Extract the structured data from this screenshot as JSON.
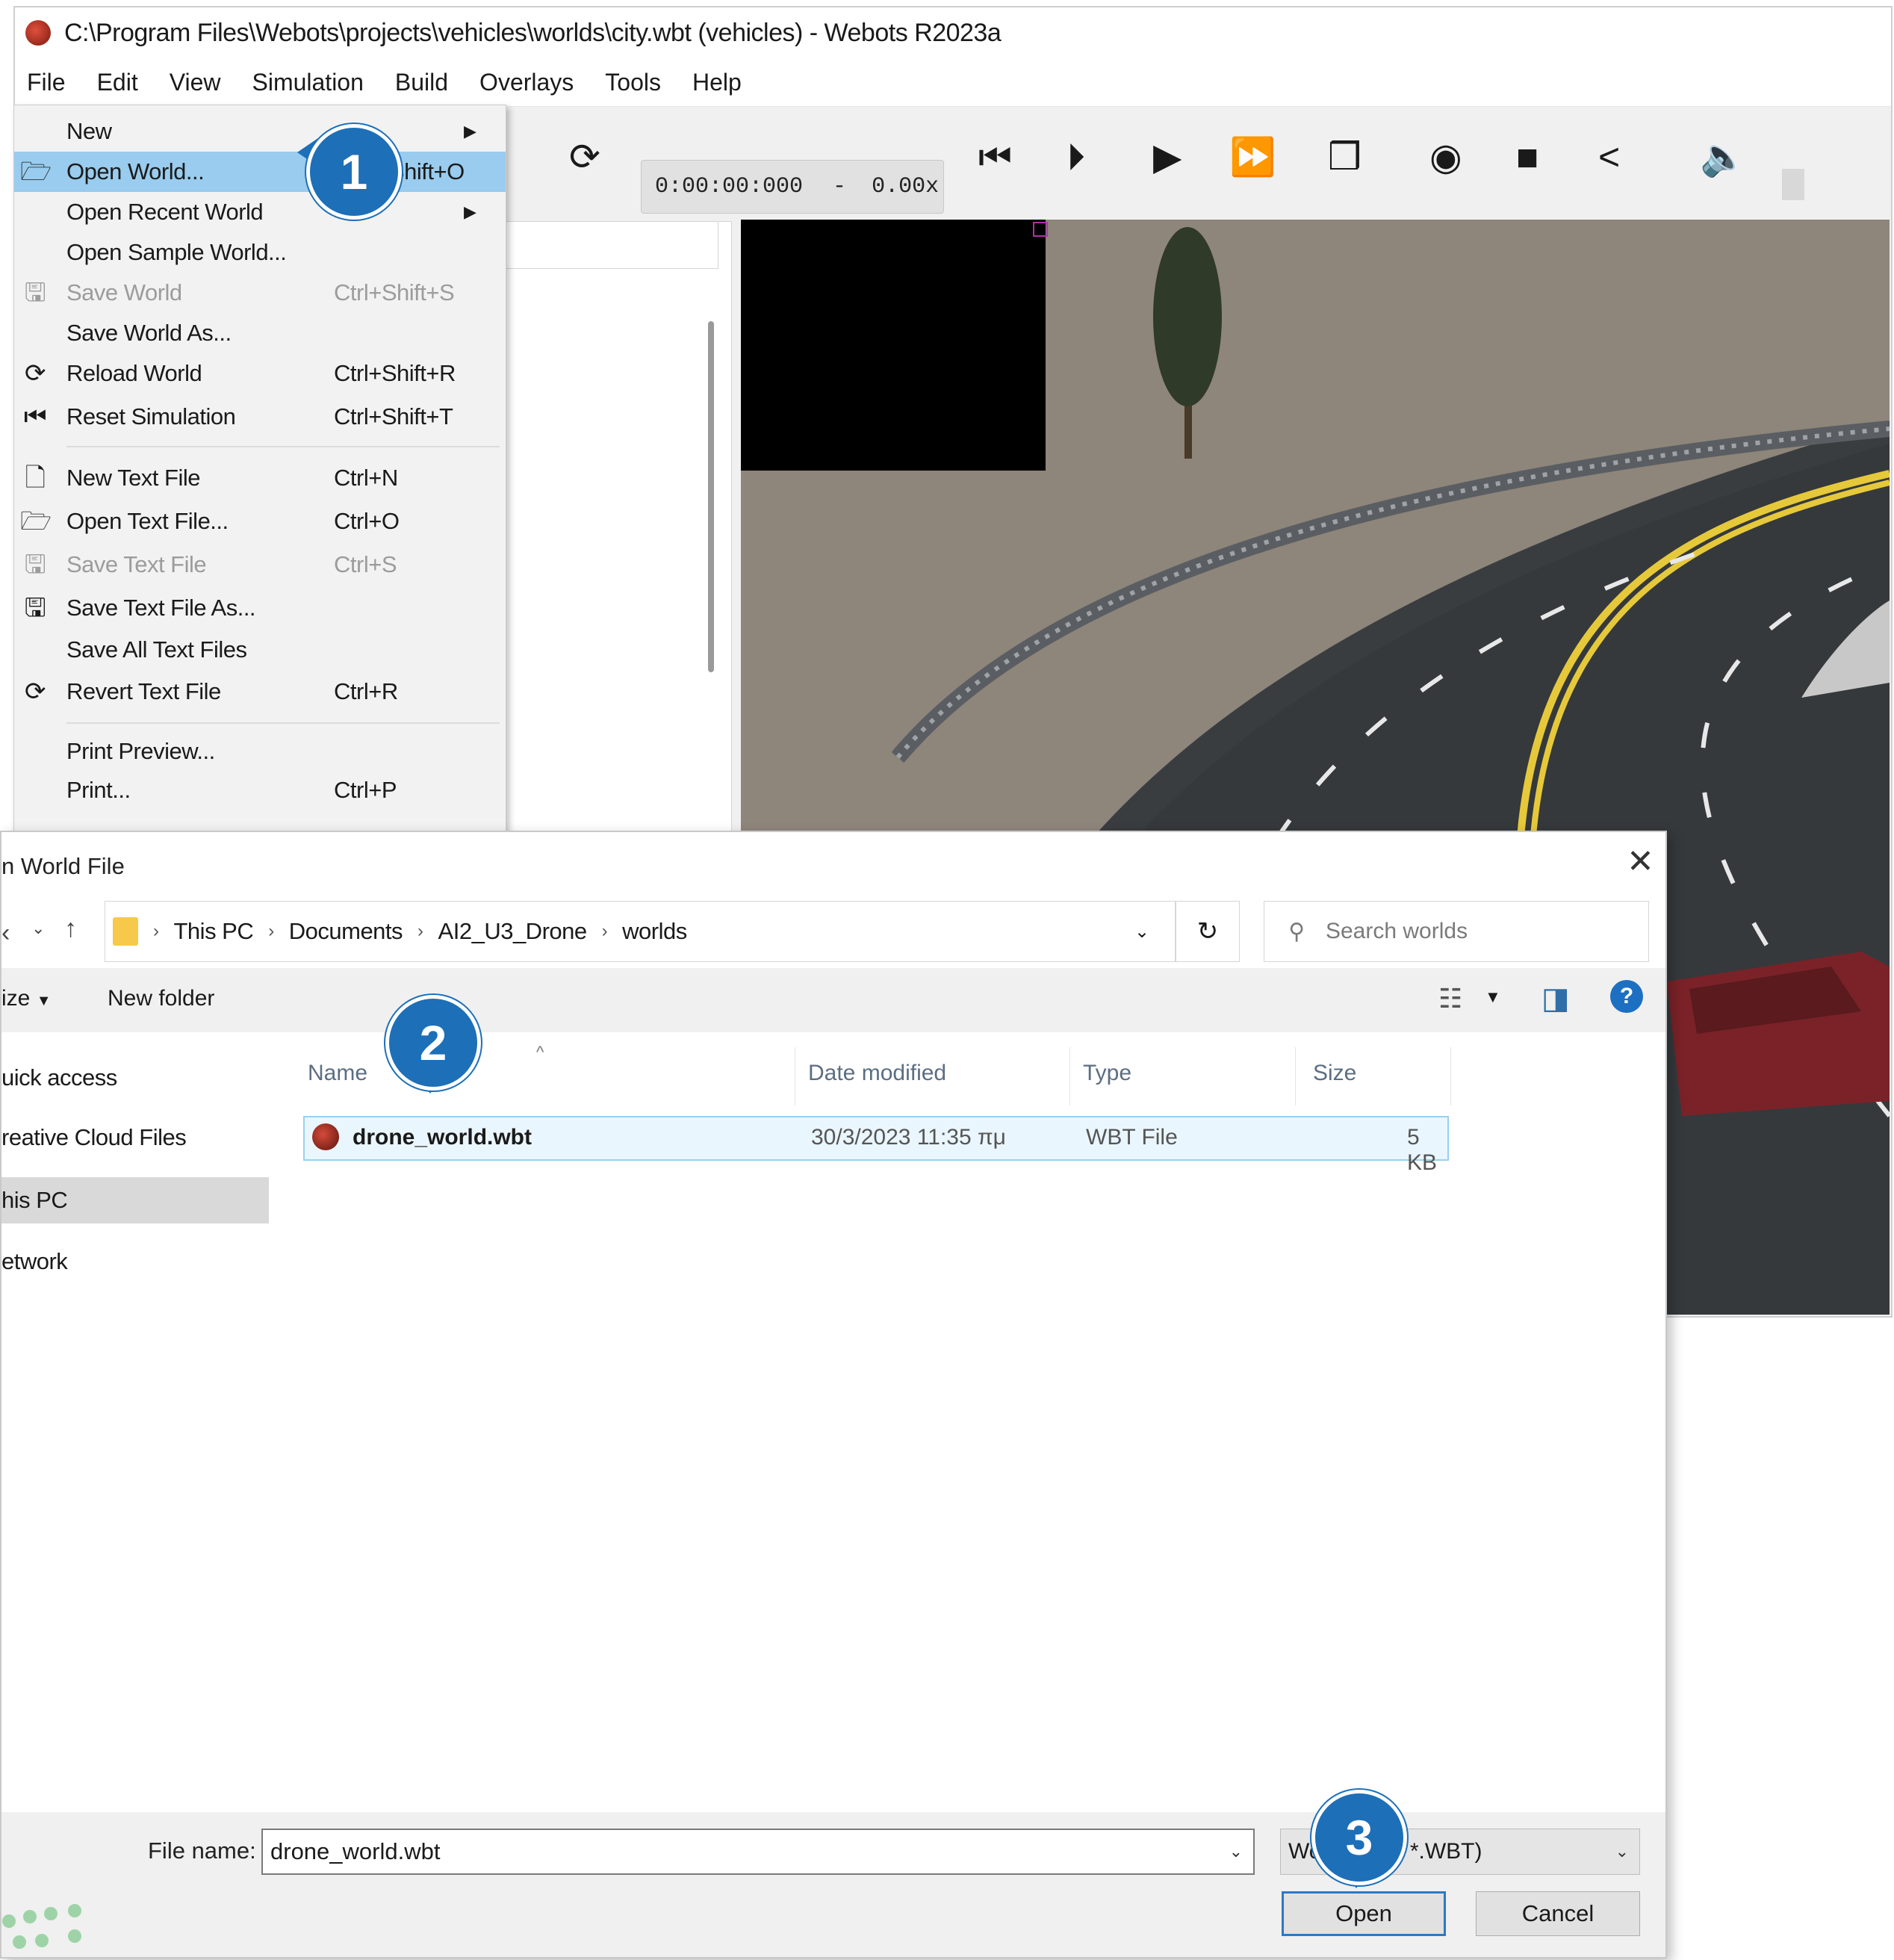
{
  "window": {
    "title": "C:\\Program Files\\Webots\\projects\\vehicles\\worlds\\city.wbt (vehicles) - Webots R2023a"
  },
  "menubar": {
    "items": [
      "File",
      "Edit",
      "View",
      "Simulation",
      "Build",
      "Overlays",
      "Tools",
      "Help"
    ]
  },
  "toolbar": {
    "time": "0:00:00:000",
    "time_sep": "-",
    "speed": "0.00x",
    "icons": [
      "reload-icon",
      "reset-icon",
      "step-icon",
      "play-icon",
      "fast-forward-icon",
      "view-icon",
      "screenshot-icon",
      "record-icon",
      "share-icon",
      "sound-icon"
    ]
  },
  "file_menu": {
    "items": [
      {
        "label": "New",
        "shortcut": "",
        "submenu": true,
        "disabled": false,
        "icon": ""
      },
      {
        "label": "Open World...",
        "shortcut": "Shift+O",
        "submenu": false,
        "disabled": false,
        "icon": "folder-open-icon",
        "highlight": true
      },
      {
        "label": "Open Recent World",
        "shortcut": "",
        "submenu": true,
        "disabled": false,
        "icon": ""
      },
      {
        "label": "Open Sample World...",
        "shortcut": "",
        "submenu": false,
        "disabled": false,
        "icon": ""
      },
      {
        "label": "Save World",
        "shortcut": "Ctrl+Shift+S",
        "submenu": false,
        "disabled": true,
        "icon": "save-icon"
      },
      {
        "label": "Save World As...",
        "shortcut": "",
        "submenu": false,
        "disabled": false,
        "icon": ""
      },
      {
        "label": "Reload World",
        "shortcut": "Ctrl+Shift+R",
        "submenu": false,
        "disabled": false,
        "icon": "reload-icon"
      },
      {
        "label": "Reset Simulation",
        "shortcut": "Ctrl+Shift+T",
        "submenu": false,
        "disabled": false,
        "icon": "reset-icon"
      },
      {
        "label": "New Text File",
        "shortcut": "Ctrl+N",
        "submenu": false,
        "disabled": false,
        "icon": "new-file-icon"
      },
      {
        "label": "Open Text File...",
        "shortcut": "Ctrl+O",
        "submenu": false,
        "disabled": false,
        "icon": "folder-open-icon"
      },
      {
        "label": "Save Text File",
        "shortcut": "Ctrl+S",
        "submenu": false,
        "disabled": true,
        "icon": "save-icon"
      },
      {
        "label": "Save Text File As...",
        "shortcut": "",
        "submenu": false,
        "disabled": false,
        "icon": "save-as-icon"
      },
      {
        "label": "Save All Text Files",
        "shortcut": "",
        "submenu": false,
        "disabled": false,
        "icon": ""
      },
      {
        "label": "Revert Text File",
        "shortcut": "Ctrl+R",
        "submenu": false,
        "disabled": false,
        "icon": "revert-icon"
      },
      {
        "label": "Print Preview...",
        "shortcut": "",
        "submenu": false,
        "disabled": false,
        "icon": ""
      },
      {
        "label": "Print...",
        "shortcut": "Ctrl+P",
        "submenu": false,
        "disabled": false,
        "icon": ""
      }
    ]
  },
  "badges": [
    "1",
    "2",
    "3"
  ],
  "dialog": {
    "title": "n World File",
    "address": {
      "crumbs": [
        "This PC",
        "Documents",
        "AI2_U3_Drone",
        "worlds"
      ]
    },
    "search_placeholder": "Search worlds",
    "organize_label": "ize",
    "new_folder_label": "New folder",
    "nav": [
      "uick access",
      "reative Cloud Files",
      "his PC",
      "etwork"
    ],
    "columns": [
      "Name",
      "Date modified",
      "Type",
      "Size"
    ],
    "files": [
      {
        "name": "drone_world.wbt",
        "date": "30/3/2023 11:35 πμ",
        "type": "WBT File",
        "size": "5 KB"
      }
    ],
    "filename_label": "File name:",
    "filename_value": "drone_world.wbt",
    "filter_value": "Wo... (*.wbt *.WBT)",
    "open_label": "Open",
    "cancel_label": "Cancel"
  },
  "colors": {
    "accent": "#1d6fb8",
    "menu_highlight": "#99ccee",
    "selection_border": "#99d1ee"
  }
}
